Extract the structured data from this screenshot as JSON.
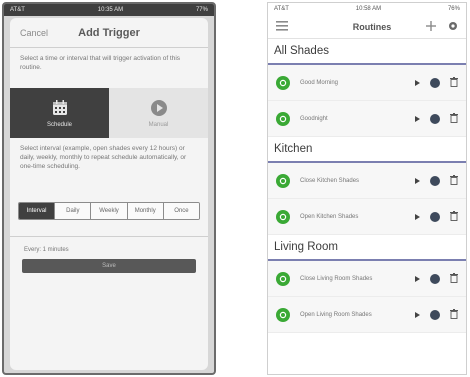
{
  "left": {
    "status": {
      "carrier": "AT&T",
      "time": "10:35 AM",
      "battery": "77%"
    },
    "header": {
      "cancel": "Cancel",
      "title": "Add Trigger"
    },
    "instructions": "Select a time or interval that will trigger activation of this routine.",
    "modes": [
      {
        "label": "Schedule",
        "icon": "calendar-icon",
        "active": true
      },
      {
        "label": "Manual",
        "icon": "play-icon",
        "active": false
      }
    ],
    "description": "Select interval (example, open shades every 12 hours) or daily, weekly, monthly to repeat schedule automatically, or one-time scheduling.",
    "frequency_tabs": [
      "Interval",
      "Daily",
      "Weekly",
      "Monthly",
      "Once"
    ],
    "frequency_active": "Interval",
    "every_text": "Every: 1 minutes",
    "save": "Save"
  },
  "right": {
    "status": {
      "carrier": "AT&T",
      "time": "10:58 AM",
      "battery": "76%"
    },
    "nav": {
      "title": "Routines",
      "menu_icon": "menu-icon",
      "add_icon": "plus-icon",
      "settings_icon": "gear-icon"
    },
    "accent": "#3aa935",
    "sections": [
      {
        "title": "All Shades",
        "routines": [
          {
            "name": "Good Morning"
          },
          {
            "name": "Goodnight"
          }
        ]
      },
      {
        "title": "Kitchen",
        "routines": [
          {
            "name": "Close Kitchen Shades"
          },
          {
            "name": "Open Kitchen Shades"
          }
        ]
      },
      {
        "title": "Living Room",
        "routines": [
          {
            "name": "Close Living Room Shades"
          },
          {
            "name": "Open Living Room Shades"
          }
        ]
      }
    ]
  }
}
